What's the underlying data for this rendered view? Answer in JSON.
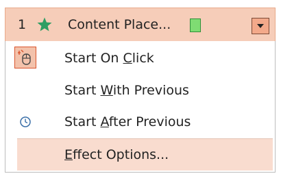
{
  "header": {
    "number": "1",
    "title": "Content Place...",
    "star_color": "#2e9e63",
    "swatch_color": "#7fdc73"
  },
  "menu": {
    "items": [
      {
        "pre": "Start On ",
        "access": "C",
        "post": "lick",
        "icon": "mouse-click-icon"
      },
      {
        "pre": "Start ",
        "access": "W",
        "post": "ith Previous",
        "icon": ""
      },
      {
        "pre": "Start ",
        "access": "A",
        "post": "fter Previous",
        "icon": "clock-icon"
      },
      {
        "pre": "",
        "access": "E",
        "post": "ffect Options...",
        "icon": ""
      }
    ]
  }
}
